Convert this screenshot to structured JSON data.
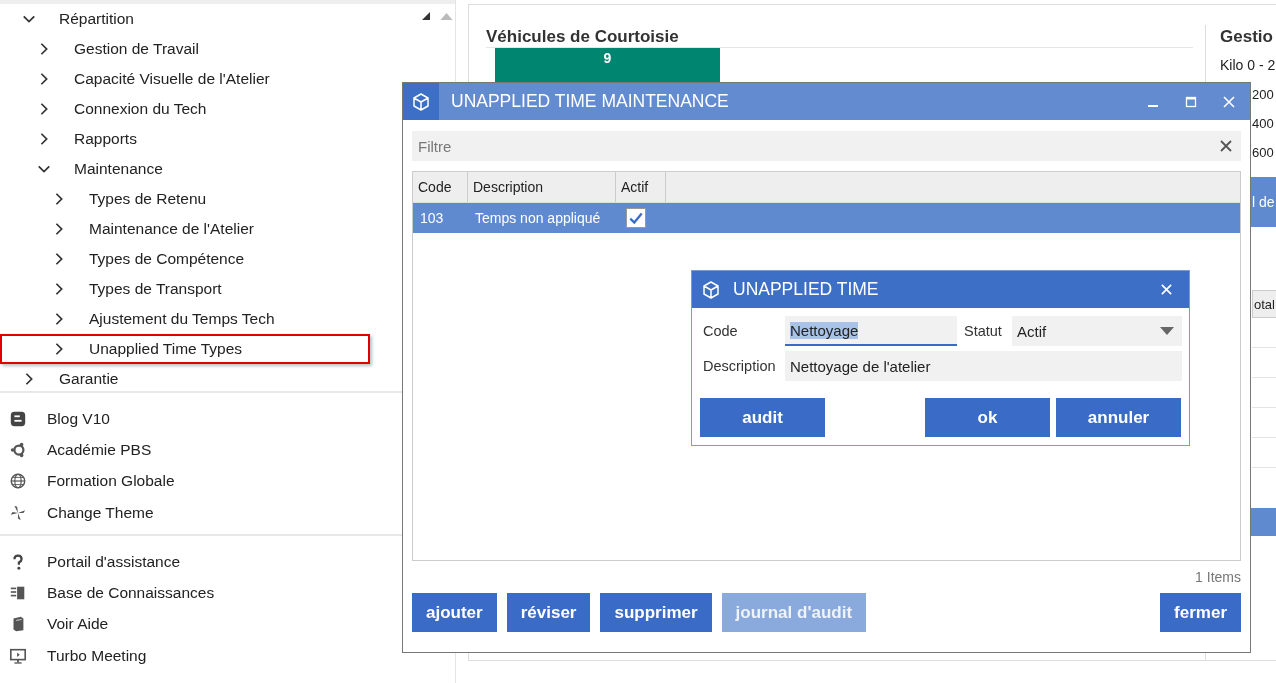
{
  "sidebar": {
    "tree": [
      {
        "label": "Répartition",
        "expanded": true,
        "highlighted": false,
        "children": [
          {
            "label": "Gestion de Travail",
            "expanded": false,
            "highlighted": false
          },
          {
            "label": "Capacité Visuelle de l'Atelier",
            "expanded": false,
            "highlighted": false
          },
          {
            "label": "Connexion du Tech",
            "expanded": false,
            "highlighted": false
          },
          {
            "label": "Rapports",
            "expanded": false,
            "highlighted": false
          },
          {
            "label": "Maintenance",
            "expanded": true,
            "highlighted": false,
            "children": [
              {
                "label": "Types de Retenu",
                "expanded": false,
                "highlighted": false
              },
              {
                "label": "Maintenance de l'Atelier",
                "expanded": false,
                "highlighted": false
              },
              {
                "label": "Types de Compétence",
                "expanded": false,
                "highlighted": false
              },
              {
                "label": "Types de Transport",
                "expanded": false,
                "highlighted": false
              },
              {
                "label": "Ajustement du Temps Tech",
                "expanded": false,
                "highlighted": false
              },
              {
                "label": "Unapplied Time Types",
                "expanded": false,
                "highlighted": true
              }
            ]
          }
        ]
      },
      {
        "label": "Garantie",
        "expanded": false,
        "highlighted": false
      }
    ],
    "links": [
      "Blog V10",
      "Académie PBS",
      "Formation Globale",
      "Change Theme"
    ],
    "help_links": [
      "Portail d'assistance",
      "Base de Connaissances",
      "Voir Aide",
      "Turbo Meeting"
    ]
  },
  "main": {
    "card_title": "Véhicules de Courtoisie",
    "bar_value": "9",
    "side_panel": {
      "title": "Gestio",
      "rows": [
        "Kilo 0 - 2",
        "200",
        "400",
        "600"
      ],
      "bar_text": "l de",
      "column_header": "otal"
    }
  },
  "dialog": {
    "title": "UNAPPLIED TIME MAINTENANCE",
    "filter": {
      "placeholder": "Filtre"
    },
    "columns": [
      "Code",
      "Description",
      "Actif"
    ],
    "rows": [
      {
        "code": "103",
        "description": "Temps non appliqué",
        "active": true,
        "selected": true
      }
    ],
    "count": "1 Items",
    "buttons": [
      {
        "label": "ajouter",
        "disabled": false
      },
      {
        "label": "réviser",
        "disabled": false
      },
      {
        "label": "supprimer",
        "disabled": false
      },
      {
        "label": "journal d'audit",
        "disabled": true
      }
    ],
    "close_button": "fermer"
  },
  "edit_dialog": {
    "title": "UNAPPLIED TIME",
    "code": {
      "label": "Code",
      "value": "Nettoyage",
      "text_selected": true
    },
    "status": {
      "label": "Statut",
      "value": "Actif"
    },
    "description": {
      "label": "Description",
      "value": "Nettoyage de l'atelier"
    },
    "left_buttons": [
      "audit"
    ],
    "right_buttons": [
      "ok",
      "annuler"
    ]
  }
}
